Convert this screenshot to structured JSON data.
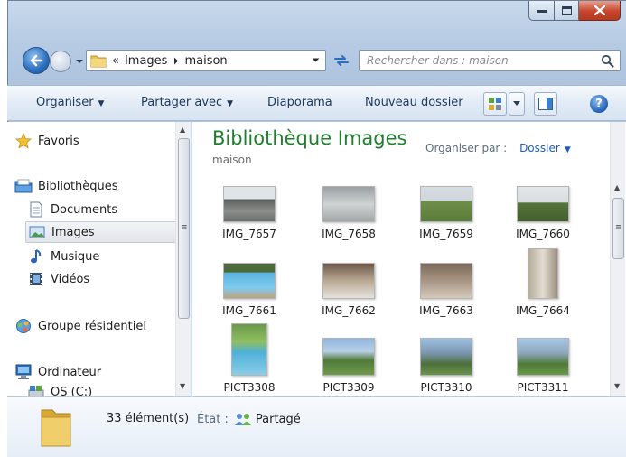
{
  "address": {
    "overflow": "«",
    "crumbs": [
      "Images",
      "maison"
    ]
  },
  "search": {
    "placeholder": "Rechercher dans : maison"
  },
  "toolbar": {
    "organize": "Organiser",
    "share": "Partager avec",
    "slideshow": "Diaporama",
    "new_folder": "Nouveau dossier"
  },
  "sidebar": {
    "favorites": "Favoris",
    "libraries": "Bibliothèques",
    "documents": "Documents",
    "images": "Images",
    "music": "Musique",
    "videos": "Vidéos",
    "homegroup": "Groupe résidentiel",
    "computer": "Ordinateur",
    "drive": "OS (C:)"
  },
  "library": {
    "title": "Bibliothèque Images",
    "subtitle": "maison",
    "arrange_label": "Organiser par :",
    "arrange_value": "Dossier"
  },
  "files": [
    {
      "name": "IMG_7657"
    },
    {
      "name": "IMG_7658"
    },
    {
      "name": "IMG_7659"
    },
    {
      "name": "IMG_7660"
    },
    {
      "name": "IMG_7661"
    },
    {
      "name": "IMG_7662"
    },
    {
      "name": "IMG_7663"
    },
    {
      "name": "IMG_7664"
    },
    {
      "name": "PICT3308"
    },
    {
      "name": "PICT3309"
    },
    {
      "name": "PICT3310"
    },
    {
      "name": "PICT3311"
    }
  ],
  "details": {
    "count": "33 élément(s)",
    "state_label": "État :",
    "state_value": "Partagé"
  },
  "colors": {
    "library_title": "#1f7f2d",
    "link_blue": "#1e5fb3",
    "command_text": "#1e395b"
  }
}
